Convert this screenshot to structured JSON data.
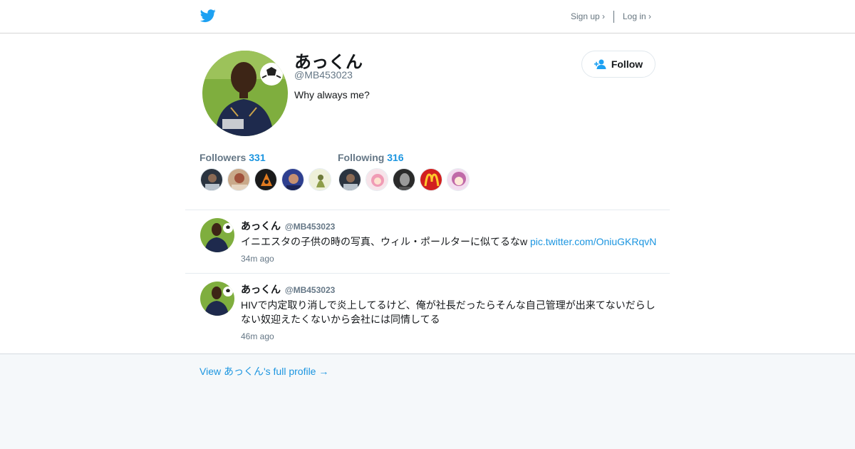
{
  "header": {
    "logo_icon": "twitter-bird-icon",
    "signup_label": "Sign up ›",
    "login_label": "Log in ›"
  },
  "profile": {
    "name": "あっくん",
    "handle": "@MB453023",
    "bio": "Why always me?",
    "follow_label": "Follow",
    "follow_icon": "add-user-icon",
    "followers_label": "Followers",
    "followers_count": "331",
    "following_label": "Following",
    "following_count": "316"
  },
  "tweets": [
    {
      "name": "あっくん",
      "handle": "@MB453023",
      "text": "イニエスタの子供の時の写真、ウィル・ポールターに似てるなw ",
      "link": "pic.twitter.com/OniuGKRqvN",
      "time": "34m ago"
    },
    {
      "name": "あっくん",
      "handle": "@MB453023",
      "text": "HIVで内定取り消しで炎上してるけど、俺が社長だったらそんな自己管理が出来てないだらしない奴迎えたくないから会社には同情してる",
      "time": "46m ago"
    }
  ],
  "footer": {
    "full_profile_label": "View あっくん's full profile →"
  },
  "colors": {
    "brand": "#1da1f2",
    "link": "#1b95e0",
    "muted": "#657786",
    "page_bg": "#f5f8fa"
  }
}
